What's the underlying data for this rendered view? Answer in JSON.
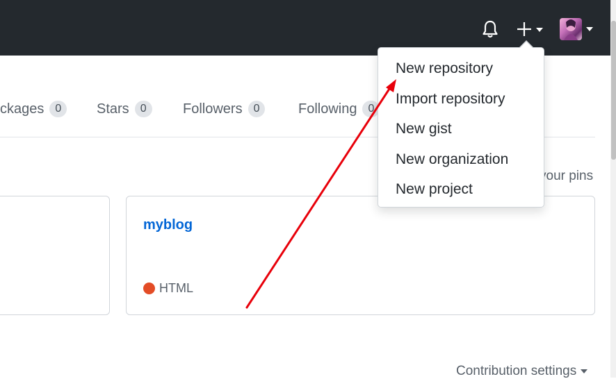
{
  "header": {
    "icons": [
      "bell-icon",
      "plus-icon",
      "avatar"
    ],
    "bg_color": "#24292e"
  },
  "profile_tabs": [
    {
      "label": "ckages",
      "count": "0"
    },
    {
      "label": "Stars",
      "count": "0"
    },
    {
      "label": "Followers",
      "count": "0"
    },
    {
      "label": "Following",
      "count": "0"
    }
  ],
  "pinned": {
    "customize_label": "your pins",
    "repo_name": "myblog",
    "language": "HTML",
    "language_color": "#e34c26"
  },
  "create_menu": {
    "items": [
      "New repository",
      "Import repository",
      "New gist",
      "New organization",
      "New project"
    ]
  },
  "contribution": {
    "settings_label": "Contribution settings"
  },
  "annotation": {
    "arrow_color": "#e8000a"
  },
  "colors": {
    "link": "#0366d6",
    "muted": "#586069",
    "border": "#d1d5da"
  }
}
